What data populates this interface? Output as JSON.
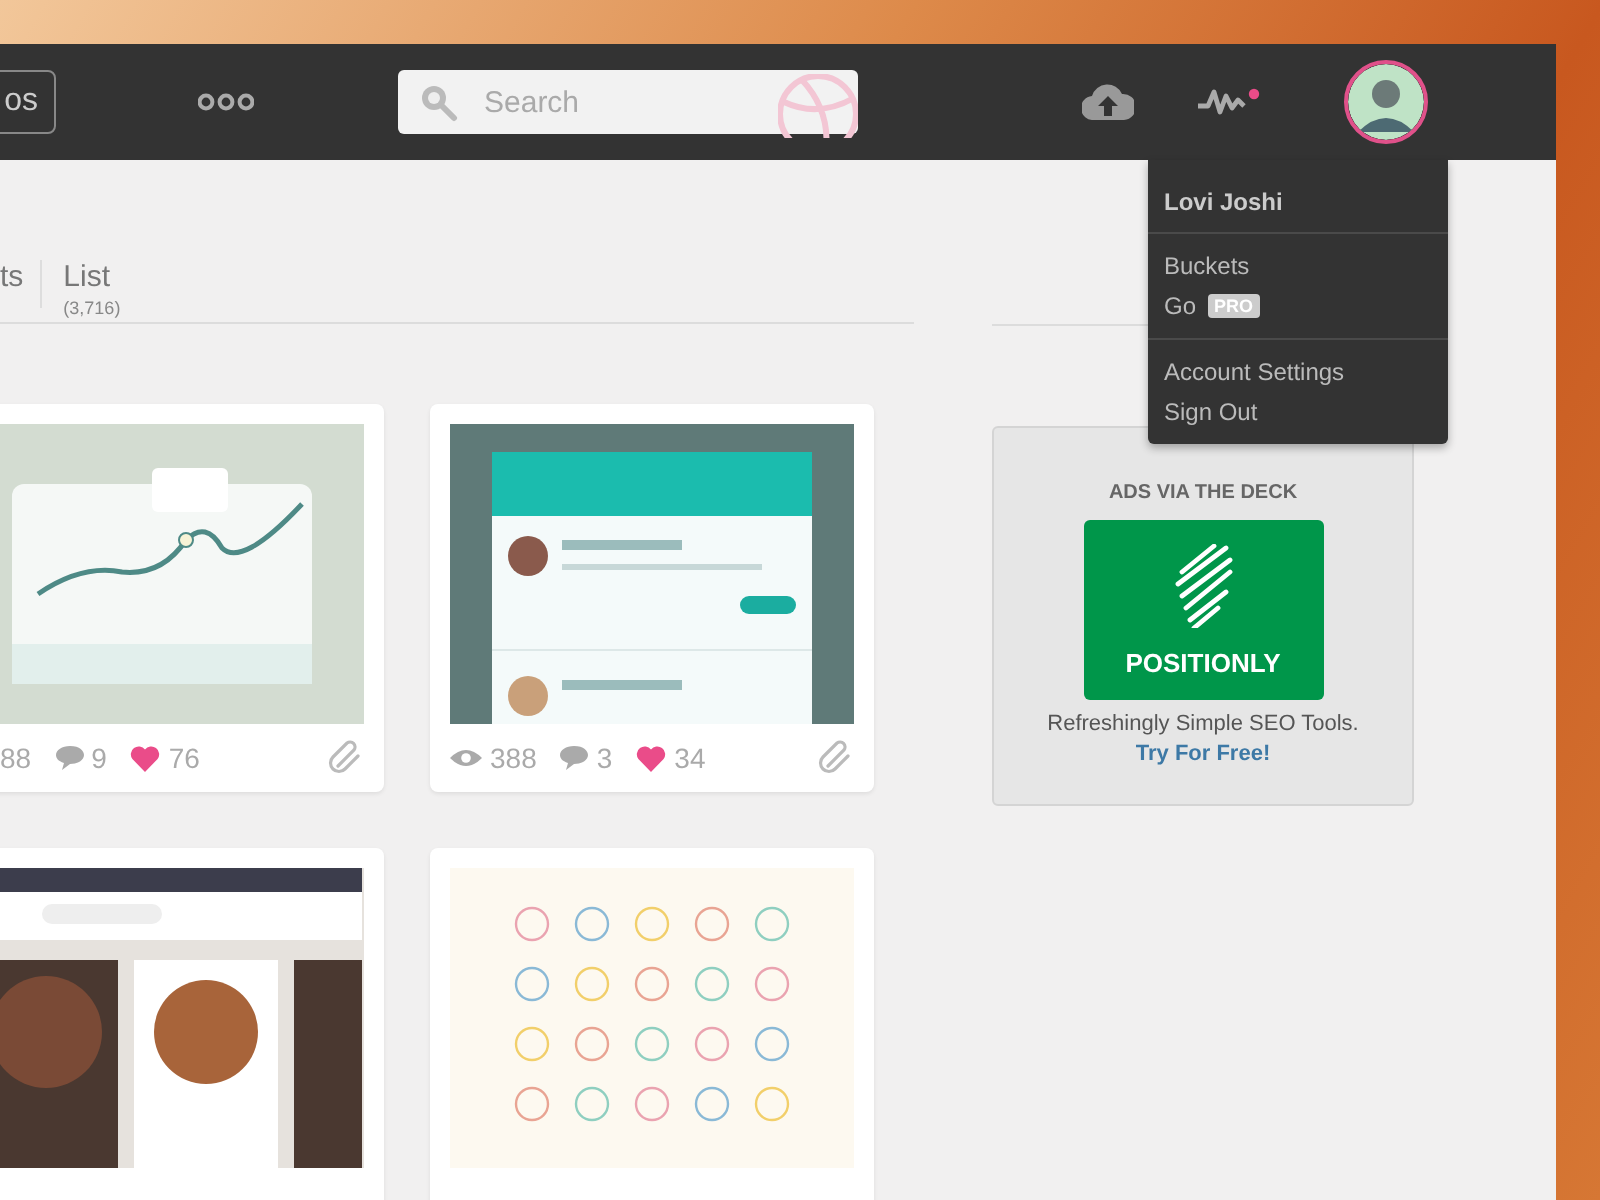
{
  "header": {
    "partial_button": "os",
    "search": {
      "placeholder": "Search"
    }
  },
  "user_menu": {
    "name": "Lovi Joshi",
    "groups": [
      [
        {
          "label": "Buckets"
        },
        {
          "label": "Go",
          "badge": "PRO"
        }
      ],
      [
        {
          "label": "Account Settings"
        },
        {
          "label": "Sign Out"
        }
      ]
    ]
  },
  "view_tabs": [
    {
      "label": "ts"
    },
    {
      "label": "List",
      "count": "(3,716)"
    }
  ],
  "shots": [
    {
      "kind": "chart",
      "stats": {
        "views": "88",
        "comments": "9",
        "likes": "76"
      }
    },
    {
      "kind": "phone",
      "stats": {
        "views": "388",
        "comments": "3",
        "likes": "34"
      }
    },
    {
      "kind": "recipes"
    },
    {
      "kind": "icons"
    }
  ],
  "ad": {
    "heading": "ADS VIA THE DECK",
    "logo_text": "POSITIONLY",
    "text": "Refreshingly Simple SEO Tools.",
    "link": "Try For Free!"
  }
}
